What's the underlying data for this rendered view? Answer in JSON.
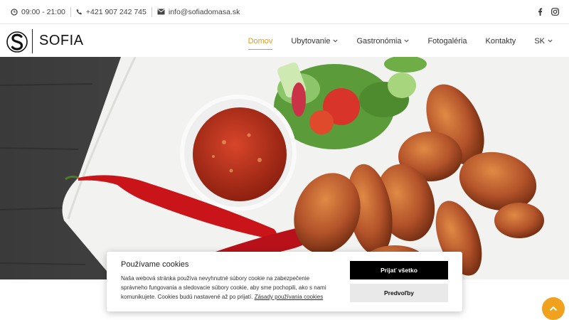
{
  "topbar": {
    "hours": "09:00 - 21:00",
    "phone": "+421 907 242 745",
    "email": "info@sofiadomasa.sk",
    "hours_icon": "clock-icon",
    "phone_icon": "phone-icon",
    "email_icon": "envelope-icon",
    "social": [
      "facebook-icon",
      "instagram-icon"
    ]
  },
  "logo": {
    "text": "SOFIA"
  },
  "nav": {
    "items": [
      {
        "label": "Domov",
        "active": true,
        "dropdown": false
      },
      {
        "label": "Ubytovanie",
        "active": false,
        "dropdown": true
      },
      {
        "label": "Gastronómia",
        "active": false,
        "dropdown": true
      },
      {
        "label": "Fotogaléria",
        "active": false,
        "dropdown": false
      },
      {
        "label": "Kontakty",
        "active": false,
        "dropdown": false
      },
      {
        "label": "SK",
        "active": false,
        "dropdown": true
      }
    ]
  },
  "slider": {
    "slide_count": 3,
    "active_slide": 2
  },
  "cookie": {
    "title": "Používame cookies",
    "text": "Naša webová stránka používa nevyhnutné súbory cookie na zabezpečenie správneho fungovania a sledovacie súbory cookie, aby sme pochopili, ako s nami komunikujete. Cookies budú nastavené až po prijatí.",
    "link": "Zásady používania cookies",
    "accept_label": "Prijať všetko",
    "pref_label": "Predvoľby"
  },
  "colors": {
    "accent": "#e39b1c",
    "to_top": "#f0a21e"
  }
}
